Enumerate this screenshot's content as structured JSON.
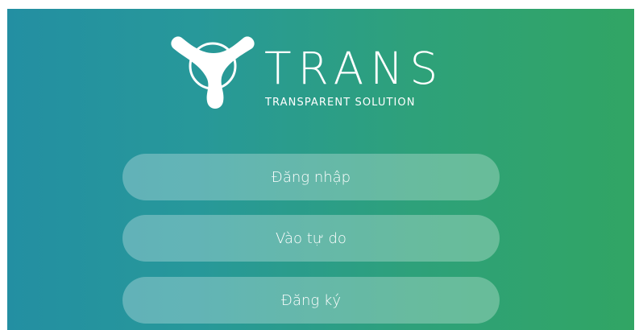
{
  "colors": {
    "gradient_start": "#238fa2",
    "gradient_end": "#31a564",
    "button_fill": "rgba(255,255,255,0.28)",
    "text": "#ffffff"
  },
  "logo": {
    "icon": "trans-logo-icon",
    "wordmark": "TRANS",
    "tagline": "TRANSPARENT SOLUTION"
  },
  "buttons": {
    "login": "Đăng nhập",
    "guest": "Vào tự do",
    "register": "Đăng ký"
  }
}
